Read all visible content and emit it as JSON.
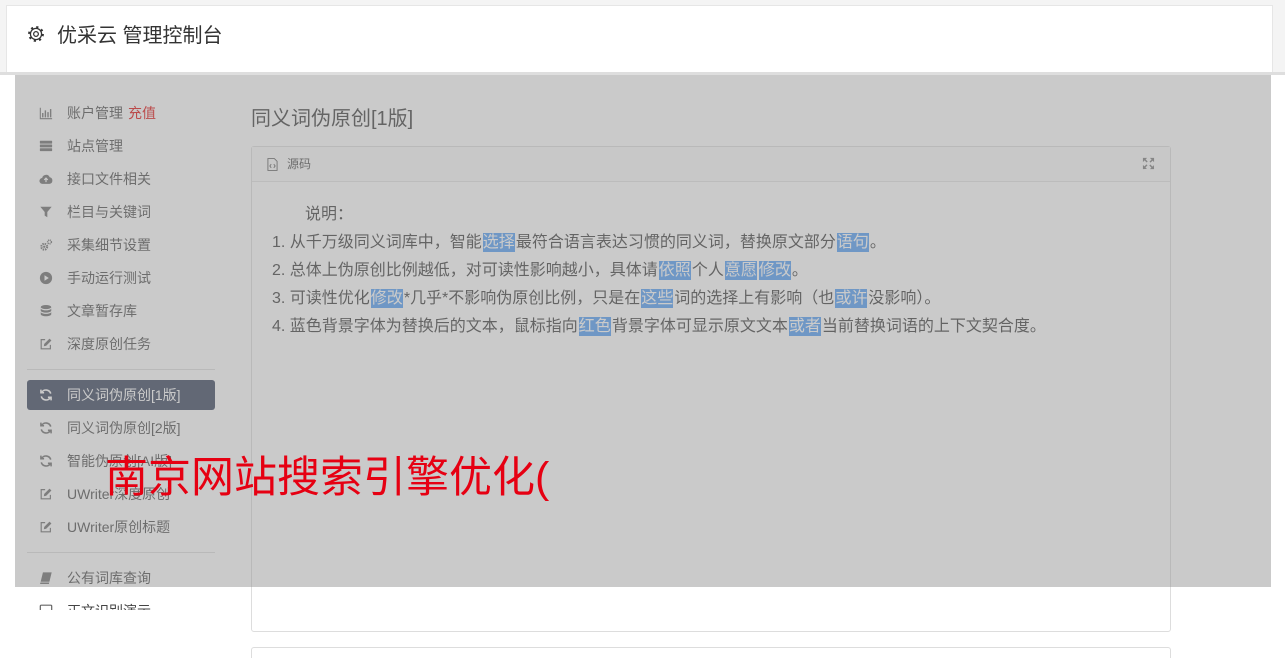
{
  "header": {
    "title": "优采云 管理控制台",
    "icon": "gear-icon"
  },
  "sidebar": {
    "items": [
      {
        "label": "账户管理",
        "icon": "bar-chart-icon",
        "badge": "充值"
      },
      {
        "label": "站点管理",
        "icon": "server-icon"
      },
      {
        "label": "接口文件相关",
        "icon": "cloud-upload-icon"
      },
      {
        "label": "栏目与关键词",
        "icon": "filter-icon"
      },
      {
        "label": "采集细节设置",
        "icon": "cogs-icon"
      },
      {
        "label": "手动运行测试",
        "icon": "play-circle-icon"
      },
      {
        "label": "文章暂存库",
        "icon": "database-icon"
      },
      {
        "label": "深度原创任务",
        "icon": "edit-icon"
      },
      {
        "label": "同义词伪原创[1版]",
        "icon": "refresh-icon",
        "active": true
      },
      {
        "label": "同义词伪原创[2版]",
        "icon": "refresh-icon"
      },
      {
        "label": "智能伪原创[AI版]",
        "icon": "refresh-icon"
      },
      {
        "label": "UWriter深度原创",
        "icon": "edit-icon"
      },
      {
        "label": "UWriter原创标题",
        "icon": "edit-icon"
      },
      {
        "label": "公有词库查询",
        "icon": "book-icon"
      },
      {
        "label": "正文识别演示",
        "icon": "square-icon"
      }
    ]
  },
  "main": {
    "page_title": "同义词伪原创[1版]",
    "panel": {
      "header_label": "源码",
      "header_icon": "code-file-icon",
      "expand_icon": "expand-icon",
      "intro": "说明：",
      "lines": [
        [
          {
            "t": "1. 从千万级同义词库中，智能"
          },
          {
            "t": "选择",
            "hl": true
          },
          {
            "t": "最符合语言表达习惯的同义词，替换原文部分"
          },
          {
            "t": "语句",
            "hl": true
          },
          {
            "t": "。"
          }
        ],
        [
          {
            "t": "2. 总体上伪原创比例越低，对可读性影响越小，具体请"
          },
          {
            "t": "依照",
            "hl": true
          },
          {
            "t": "个人"
          },
          {
            "t": "意愿",
            "hl": true
          },
          {
            "t": "修改",
            "hl": true
          },
          {
            "t": "。"
          }
        ],
        [
          {
            "t": "3. 可读性优化"
          },
          {
            "t": "修改",
            "hl": true
          },
          {
            "t": "*几乎*不影响伪原创比例，只是在"
          },
          {
            "t": "这些",
            "hl": true
          },
          {
            "t": "词的选择上有影响（也"
          },
          {
            "t": "或许",
            "hl": true
          },
          {
            "t": "没影响）。"
          }
        ],
        [
          {
            "t": "4. 蓝色背景字体为替换后的文本，鼠标指向"
          },
          {
            "t": "红色",
            "hl": true
          },
          {
            "t": "背景字体可显示原文文本"
          },
          {
            "t": "或者",
            "hl": true
          },
          {
            "t": "当前替换词语的上下文契合度。"
          }
        ]
      ]
    }
  },
  "overlay_text": "南京网站搜索引擎优化(",
  "colors": {
    "highlight_bg": "#4899f5",
    "active_item_bg": "#2f3b55",
    "recharge": "#e00000",
    "overlay_text": "#e60012"
  }
}
